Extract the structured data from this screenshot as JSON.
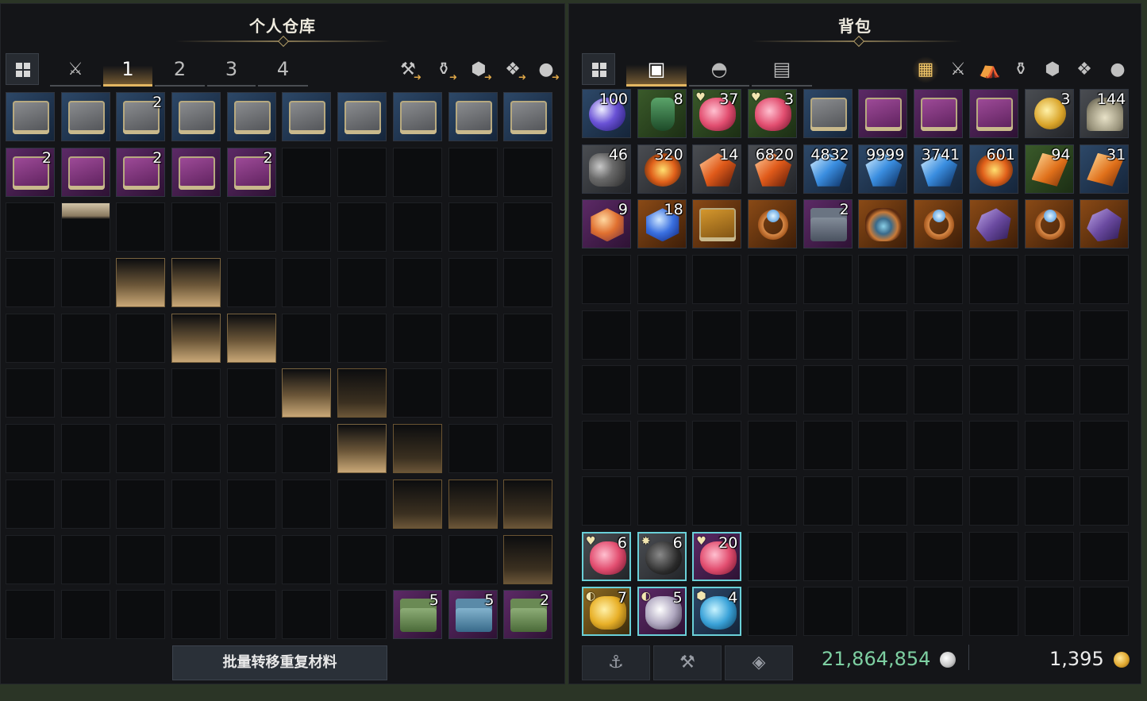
{
  "warehouse": {
    "title": "个人仓库",
    "tabs": [
      "1",
      "2",
      "3",
      "4"
    ],
    "active_tab": "1",
    "bulk_button": "批量转移重复材料",
    "items": [
      {
        "q": "blue",
        "icon": "book",
        "count": ""
      },
      {
        "q": "blue",
        "icon": "book",
        "count": ""
      },
      {
        "q": "blue",
        "icon": "book",
        "count": "2"
      },
      {
        "q": "blue",
        "icon": "book",
        "count": ""
      },
      {
        "q": "blue",
        "icon": "book",
        "count": ""
      },
      {
        "q": "blue",
        "icon": "book",
        "count": ""
      },
      {
        "q": "blue",
        "icon": "book",
        "count": ""
      },
      {
        "q": "blue",
        "icon": "book",
        "count": ""
      },
      {
        "q": "blue",
        "icon": "book",
        "count": ""
      },
      {
        "q": "blue",
        "icon": "book",
        "count": ""
      },
      {
        "q": "purple",
        "icon": "book pur",
        "count": "2"
      },
      {
        "q": "purple",
        "icon": "book pur",
        "count": ""
      },
      {
        "q": "purple",
        "icon": "book pur",
        "count": "2"
      },
      {
        "q": "purple",
        "icon": "book pur",
        "count": ""
      },
      {
        "q": "purple",
        "icon": "book pur",
        "count": "2"
      },
      {},
      {},
      {},
      {},
      {},
      {},
      {
        "special": "sliver"
      },
      {},
      {},
      {},
      {},
      {},
      {},
      {},
      {},
      {},
      {},
      {
        "special": "glow"
      },
      {
        "special": "glow"
      },
      {},
      {},
      {},
      {},
      {},
      {},
      {},
      {},
      {},
      {
        "special": "glow"
      },
      {
        "special": "glow"
      },
      {},
      {},
      {},
      {},
      {},
      {},
      {},
      {},
      {},
      {},
      {
        "special": "glow"
      },
      {
        "special": "glow2"
      },
      {},
      {},
      {},
      {},
      {},
      {},
      {},
      {},
      {},
      {
        "special": "glow"
      },
      {
        "special": "glow2"
      },
      {},
      {},
      {},
      {},
      {},
      {},
      {},
      {},
      {},
      {
        "special": "glow2"
      },
      {
        "special": "glow2"
      },
      {
        "special": "glow2"
      },
      {},
      {},
      {},
      {},
      {},
      {},
      {},
      {},
      {},
      {
        "special": "glow2"
      },
      {},
      {},
      {},
      {},
      {},
      {},
      {},
      {
        "q": "purple",
        "icon": "chest green",
        "count": "5"
      },
      {
        "q": "purple",
        "icon": "chest blue",
        "count": "5"
      },
      {
        "q": "purple",
        "icon": "chest green",
        "count": "2"
      }
    ],
    "filters": [
      "weapon-armor-icon",
      "potion-icon",
      "gem-icon",
      "card-icon",
      "chat-icon"
    ]
  },
  "backpack": {
    "title": "背包",
    "tabs": [
      "all-items-icon",
      "bag-icon",
      "helmet-icon",
      "book-icon"
    ],
    "active_tab": "bag-icon",
    "filters": [
      "grid-icon",
      "crossed-swords-icon",
      "camp-icon",
      "potion-icon",
      "gem-icon",
      "card-icon",
      "chat-icon"
    ],
    "active_filter": "grid-icon",
    "items": [
      {
        "q": "blue",
        "icon": "orb",
        "count": "100"
      },
      {
        "q": "green",
        "icon": "bottle-g",
        "count": "8"
      },
      {
        "q": "green",
        "icon": "pot-r",
        "count": "37",
        "badge": "♥"
      },
      {
        "q": "green",
        "icon": "pot-r",
        "count": "3",
        "badge": "♥"
      },
      {
        "q": "blue",
        "icon": "book",
        "count": ""
      },
      {
        "q": "purple",
        "icon": "book pur",
        "count": ""
      },
      {
        "q": "purple",
        "icon": "book pur",
        "count": ""
      },
      {
        "q": "purple",
        "icon": "book pur",
        "count": ""
      },
      {
        "q": "gray",
        "icon": "coin",
        "count": "3"
      },
      {
        "q": "gray",
        "icon": "dust",
        "count": "144"
      },
      {
        "q": "gray",
        "icon": "ore",
        "count": "46"
      },
      {
        "q": "gray",
        "icon": "fire",
        "count": "320"
      },
      {
        "q": "gray",
        "icon": "shard-o",
        "count": "14"
      },
      {
        "q": "gray",
        "icon": "shard-o",
        "count": "6820"
      },
      {
        "q": "blue",
        "icon": "shard-b",
        "count": "4832"
      },
      {
        "q": "blue",
        "icon": "shard-b",
        "count": "9999"
      },
      {
        "q": "blue",
        "icon": "shard-b",
        "count": "3741"
      },
      {
        "q": "blue",
        "icon": "fire",
        "count": "601"
      },
      {
        "q": "green",
        "icon": "crys-o",
        "count": "94"
      },
      {
        "q": "blue",
        "icon": "crys-o",
        "count": "31"
      },
      {
        "q": "purple",
        "icon": "gem-o",
        "count": "9"
      },
      {
        "q": "orange",
        "icon": "gem-b",
        "count": "18"
      },
      {
        "q": "orange",
        "icon": "book gold",
        "count": ""
      },
      {
        "q": "orange",
        "icon": "ring",
        "count": ""
      },
      {
        "q": "purple",
        "icon": "chest",
        "count": "2"
      },
      {
        "q": "orange",
        "icon": "amul",
        "count": ""
      },
      {
        "q": "orange",
        "icon": "ring",
        "count": ""
      },
      {
        "q": "orange",
        "icon": "amet",
        "count": ""
      },
      {
        "q": "orange",
        "icon": "ring",
        "count": ""
      },
      {
        "q": "orange",
        "icon": "amet",
        "count": ""
      },
      {},
      {},
      {},
      {},
      {},
      {},
      {},
      {},
      {},
      {},
      {},
      {},
      {},
      {},
      {},
      {},
      {},
      {},
      {},
      {},
      {},
      {},
      {},
      {},
      {},
      {},
      {},
      {},
      {},
      {},
      {},
      {},
      {},
      {},
      {},
      {},
      {},
      {},
      {},
      {},
      {},
      {},
      {},
      {},
      {},
      {},
      {},
      {},
      {},
      {},
      {
        "q": "gray",
        "icon": "pot-r",
        "count": "6",
        "badge": "♥",
        "sel": true
      },
      {
        "q": "gray",
        "icon": "bomb",
        "count": "6",
        "badge": "✸",
        "sel": true
      },
      {
        "q": "purple",
        "icon": "pot-r",
        "count": "20",
        "badge": "♥",
        "sel": true
      },
      {},
      {},
      {},
      {},
      {},
      {},
      {},
      {
        "q": "gold",
        "icon": "pot-y",
        "count": "7",
        "badge": "◐",
        "sel": true
      },
      {
        "q": "purple",
        "icon": "pot-w",
        "count": "5",
        "badge": "◐",
        "sel": true
      },
      {
        "q": "blue",
        "icon": "pot-b",
        "count": "4",
        "badge": "⬢",
        "sel": true
      },
      {},
      {},
      {},
      {},
      {},
      {},
      {}
    ],
    "bottom_buttons": [
      "anchor-icon",
      "hammer-icon",
      "gem-cut-icon"
    ],
    "silver": "21,864,854",
    "gold": "1,395",
    "colors": {
      "silver_text": "#7ed0a2",
      "gold_text": "#ececec",
      "silver_coin": "#c8c8c8",
      "gold_coin": "#e0a830"
    }
  }
}
